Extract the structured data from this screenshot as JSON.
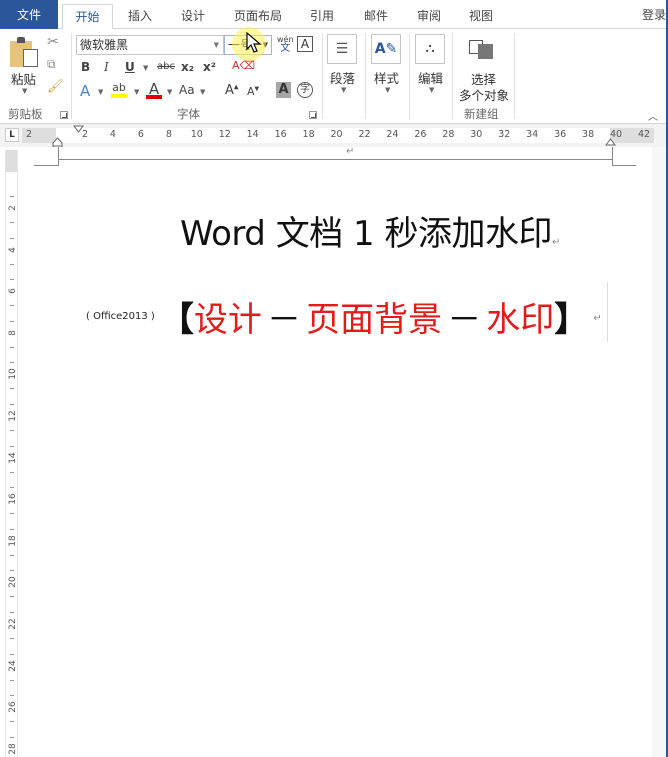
{
  "tabs": {
    "file": "文件",
    "items": [
      "开始",
      "插入",
      "设计",
      "页面布局",
      "引用",
      "邮件",
      "审阅",
      "视图"
    ],
    "active": "开始",
    "login": "登录"
  },
  "ribbon": {
    "clipboard": {
      "paste_label": "粘贴",
      "group_label": "剪贴板"
    },
    "font": {
      "font_name": "微软雅黑",
      "font_size": "一号",
      "bold": "B",
      "italic": "I",
      "underline": "U",
      "strikethrough": "abc",
      "subscript": "x₂",
      "superscript": "x²",
      "text_effects": "A",
      "highlight": "ab",
      "font_color": "A",
      "change_case": "Aa",
      "grow_font": "A",
      "shrink_font": "A",
      "char_shading": "A",
      "enclose_char": "字",
      "phonetic_top": "wén",
      "phonetic_bottom": "文",
      "char_border": "A",
      "group_label": "字体",
      "highlight_color": "#ffff00",
      "font_color_value": "#e00000"
    },
    "paragraph": {
      "label": "段落"
    },
    "styles": {
      "label": "样式"
    },
    "editing": {
      "label": "编辑"
    },
    "new_group": {
      "button_line1": "选择",
      "button_line2": "多个对象",
      "group_label": "新建组"
    }
  },
  "ruler": {
    "tab_selector": "L",
    "h_labels": [
      "2",
      "2",
      "4",
      "6",
      "8",
      "10",
      "12",
      "14",
      "16",
      "18",
      "20",
      "22",
      "24",
      "26",
      "28",
      "30",
      "32",
      "34",
      "36",
      "38",
      "40",
      "42"
    ],
    "v_labels": [
      "2",
      "4",
      "6",
      "8",
      "10",
      "12",
      "14",
      "16",
      "18",
      "20",
      "22",
      "24",
      "26",
      "28"
    ]
  },
  "document": {
    "title": "Word 文档 1 秒添加水印",
    "note": "( Office2013 )",
    "bracket_open": "【",
    "part1": "设计",
    "dash": "－",
    "part2": "页面背景",
    "part3": "水印",
    "bracket_close": "】",
    "para_mark": "↵"
  },
  "colors": {
    "accent": "#2b579a",
    "red_text": "#e21b1b"
  }
}
